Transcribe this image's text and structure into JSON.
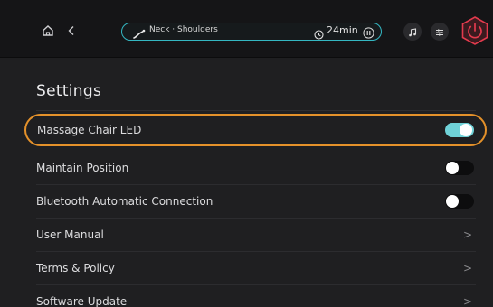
{
  "topbar": {
    "home_icon": "home-icon",
    "back_icon": "back-chevron-icon",
    "program": {
      "label": "Neck · Shoulders",
      "icon": "massage-program-icon",
      "timer": "24min",
      "accent": "#34b7c2"
    },
    "music_icon": "music-note-icon",
    "equalizer_icon": "sliders-icon",
    "power_icon": "power-icon",
    "power_color": "#e23a4d"
  },
  "settings": {
    "title": "Settings",
    "highlight_color": "#e4912a",
    "items": [
      {
        "label": "Massage Chair LED",
        "control": "toggle",
        "state": "on"
      },
      {
        "label": "Maintain Position",
        "control": "toggle",
        "state": "off"
      },
      {
        "label": "Bluetooth Automatic Connection",
        "control": "toggle",
        "state": "off"
      },
      {
        "label": "User Manual",
        "control": "chevron",
        "chevron": ">"
      },
      {
        "label": "Terms & Policy",
        "control": "chevron",
        "chevron": ">"
      },
      {
        "label": "Software Update",
        "control": "chevron",
        "chevron": ">"
      }
    ]
  }
}
